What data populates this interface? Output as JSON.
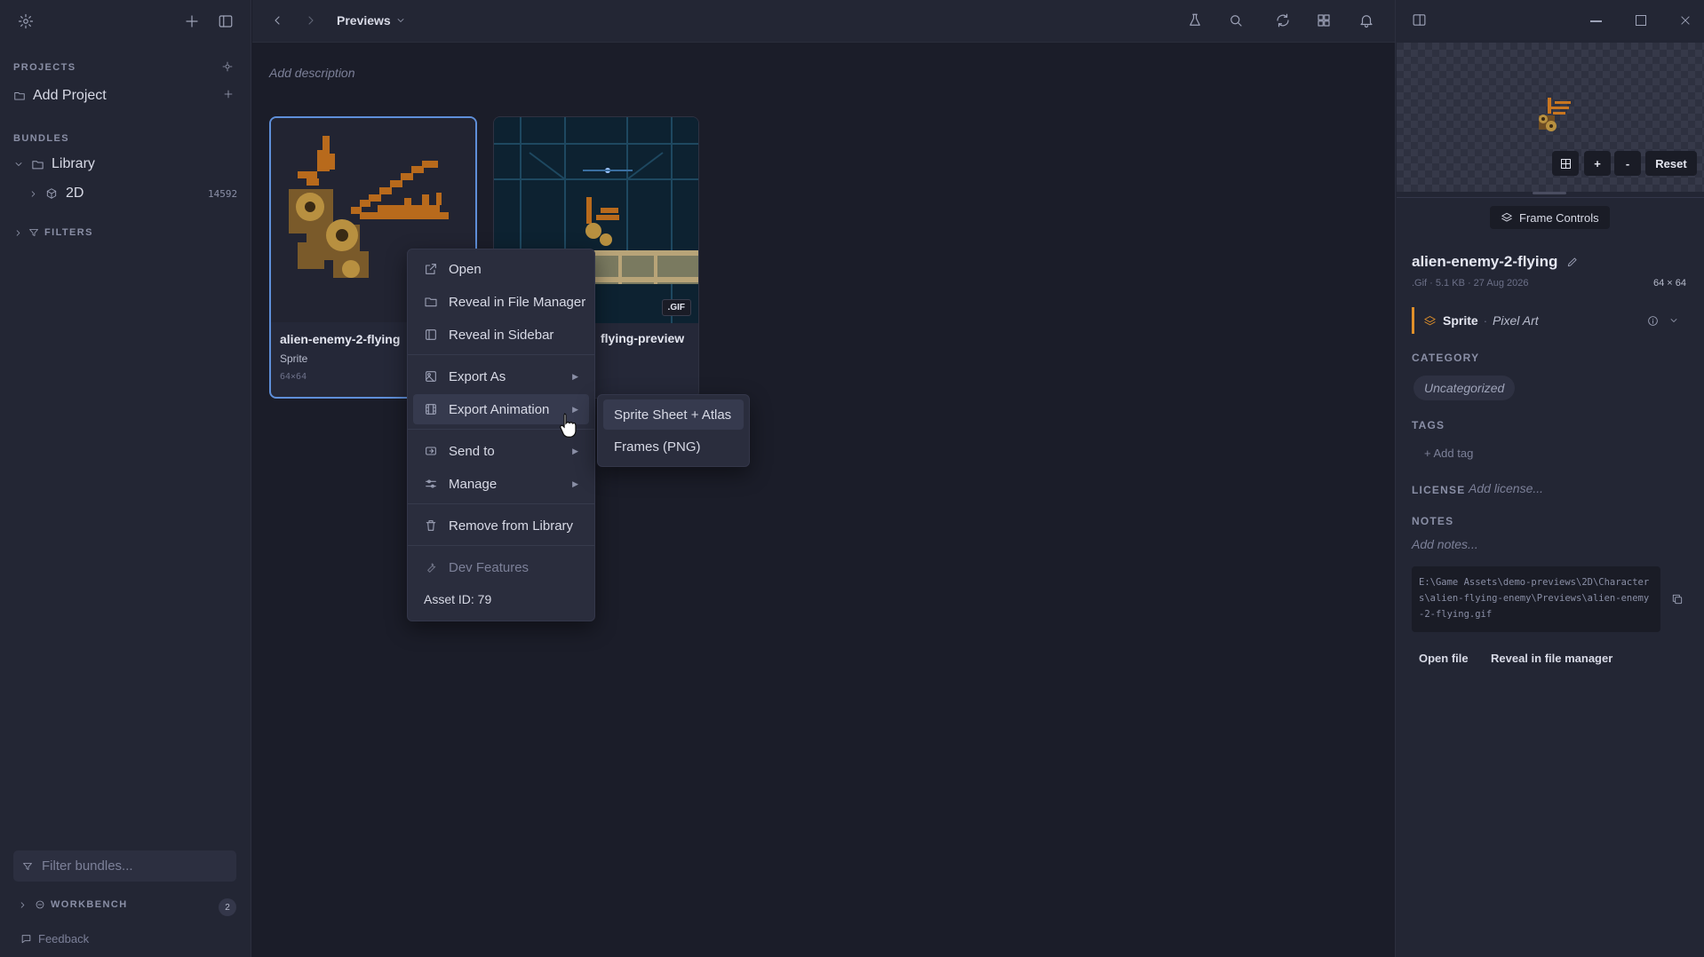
{
  "sidebar": {
    "projects_label": "PROJECTS",
    "add_project": "Add Project",
    "bundles_label": "BUNDLES",
    "library": "Library",
    "folder_2d": "2D",
    "folder_2d_count": "14592",
    "filters_label": "FILTERS",
    "filter_placeholder": "Filter bundles...",
    "workbench_label": "WORKBENCH",
    "workbench_count": "2",
    "feedback": "Feedback"
  },
  "topbar": {
    "breadcrumb": "Previews"
  },
  "main": {
    "description_placeholder": "Add description",
    "cards": [
      {
        "title": "alien-enemy-2-flying",
        "subtitle": "Sprite",
        "dims": "64×64",
        "selected": true
      },
      {
        "title": "flying-preview",
        "badge": ".GIF",
        "selected": false
      }
    ]
  },
  "context_menu": {
    "items": [
      {
        "label": "Open",
        "icon": "external-link-icon"
      },
      {
        "label": "Reveal in File Manager",
        "icon": "folder-open-icon"
      },
      {
        "label": "Reveal in Sidebar",
        "icon": "sidebar-icon"
      },
      {
        "label": "Export As",
        "icon": "image-icon",
        "submenu": true
      },
      {
        "label": "Export Animation",
        "icon": "film-icon",
        "submenu": true,
        "highlighted": true
      },
      {
        "label": "Send to",
        "icon": "send-icon",
        "submenu": true
      },
      {
        "label": "Manage",
        "icon": "sliders-icon",
        "submenu": true
      },
      {
        "label": "Remove from Library",
        "icon": "trash-icon"
      },
      {
        "label": "Dev Features",
        "icon": "wrench-icon",
        "disabled": true
      }
    ],
    "asset_id": "Asset ID: 79",
    "submenu": {
      "items": [
        "Sprite Sheet + Atlas",
        "Frames (PNG)"
      ]
    }
  },
  "right_panel": {
    "preview_reset": "Reset",
    "preview_plus": "+",
    "preview_minus": "-",
    "frame_controls": "Frame Controls",
    "asset_name": "alien-enemy-2-flying",
    "meta": ".Gif · 5.1 KB · 27 Aug 2026",
    "dims": "64 × 64",
    "type": "Sprite",
    "type_sep": "·",
    "style": "Pixel Art",
    "category_label": "CATEGORY",
    "category": "Uncategorized",
    "tags_label": "TAGS",
    "add_tag": "+ Add tag",
    "license_label": "LICENSE",
    "license_placeholder": "Add license...",
    "notes_label": "NOTES",
    "notes_placeholder": "Add notes...",
    "path": "E:\\Game Assets\\demo-previews\\2D\\Characters\\alien-flying-enemy\\Previews\\alien-enemy-2-flying.gif",
    "open_file": "Open file",
    "reveal": "Reveal in file manager"
  },
  "colors": {
    "accent_orange": "#e0902a",
    "selection_blue": "#5f8fd9",
    "background": "#1b1d29"
  }
}
